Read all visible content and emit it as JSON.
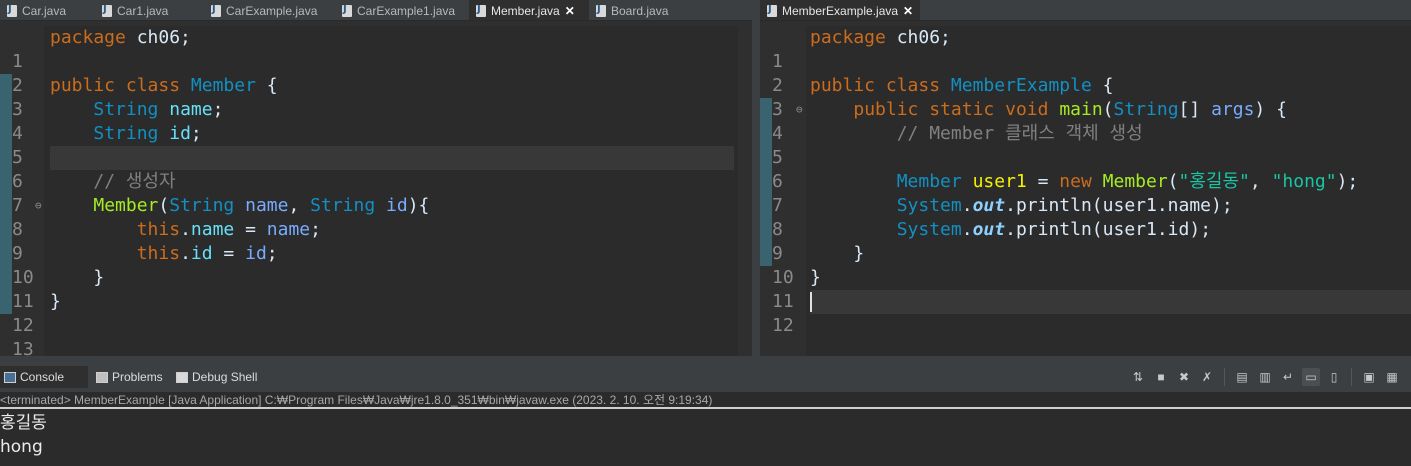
{
  "left_editor": {
    "tabs": [
      {
        "label": "Car.java"
      },
      {
        "label": "Car1.java"
      },
      {
        "label": "CarExample.java"
      },
      {
        "label": "CarExample1.java"
      },
      {
        "label": "Member.java"
      },
      {
        "label": "Board.java"
      }
    ],
    "active_tab": "Member.java",
    "line_numbers": [
      "1",
      "2",
      "3",
      "4",
      "5",
      "6",
      "7",
      "8",
      "9",
      "10",
      "11",
      "12",
      "13"
    ],
    "code": {
      "l1_kw": "package",
      "l1_rest": " ch06;",
      "l3_kw1": "public",
      "l3_kw2": "class",
      "l3_name": "Member",
      "l3_brace": " {",
      "l4_type": "String",
      "l4_field": "name",
      "l4_semi": ";",
      "l5_type": "String",
      "l5_field": "id",
      "l5_semi": ";",
      "l7_comment": "// 생성자",
      "l8_ctor": "Member",
      "l8_open": "(",
      "l8_type1": "String",
      "l8_param1": "name",
      "l8_comma": ", ",
      "l8_type2": "String",
      "l8_param2": "id",
      "l8_close": "){",
      "l9_this": "this",
      "l9_dot": ".",
      "l9_field": "name",
      "l9_eq": " = ",
      "l9_param": "name",
      "l9_semi": ";",
      "l10_this": "this",
      "l10_dot": ".",
      "l10_field": "id",
      "l10_eq": " = ",
      "l10_param": "id",
      "l10_semi": ";",
      "l11_brace": "}",
      "l12_brace": "}"
    }
  },
  "right_editor": {
    "tab": {
      "label": "MemberExample.java"
    },
    "line_numbers": [
      "1",
      "2",
      "3",
      "4",
      "5",
      "6",
      "7",
      "8",
      "9",
      "10",
      "11",
      "12"
    ],
    "code": {
      "l1_kw": "package",
      "l1_rest": " ch06;",
      "l3_kw1": "public",
      "l3_kw2": "class",
      "l3_name": "MemberExample",
      "l3_brace": " {",
      "l4_kw1": "public",
      "l4_kw2": "static",
      "l4_kw3": "void",
      "l4_method": "main",
      "l4_open": "(",
      "l4_type": "String",
      "l4_arr": "[] ",
      "l4_param": "args",
      "l4_close": ") {",
      "l5_comment": "// Member 클래스 객체 생성",
      "l7_type": "Member",
      "l7_var": "user1",
      "l7_eq": " = ",
      "l7_new": "new",
      "l7_ctor": "Member",
      "l7_open": "(",
      "l7_str1": "\"홍길동\"",
      "l7_comma": ", ",
      "l7_str2": "\"hong\"",
      "l7_close": ");",
      "l8_sys": "System",
      "l8_dot1": ".",
      "l8_out": "out",
      "l8_dot2": ".",
      "l8_method": "println",
      "l8_open": "(",
      "l8_var": "user1",
      "l8_dot3": ".",
      "l8_field": "name",
      "l8_close": ");",
      "l9_sys": "System",
      "l9_dot1": ".",
      "l9_out": "out",
      "l9_dot2": ".",
      "l9_method": "println",
      "l9_open": "(",
      "l9_var": "user1",
      "l9_dot3": ".",
      "l9_field": "id",
      "l9_close": ");",
      "l10_brace": "}",
      "l11_brace": "}"
    }
  },
  "console": {
    "tabs": [
      {
        "label": "Console"
      },
      {
        "label": "Problems"
      },
      {
        "label": "Debug Shell"
      }
    ],
    "toolbar_icons": [
      "sync-icon",
      "stop-icon",
      "remove-icon",
      "remove-all-icon",
      "clear-console-icon",
      "scroll-lock-icon",
      "word-wrap-icon",
      "show-stdout-icon",
      "show-stderr-icon",
      "pin-console-icon",
      "new-console-icon"
    ],
    "status": "<terminated> MemberExample [Java Application] C:₩Program Files₩Java₩jre1.8.0_351₩bin₩javaw.exe (2023. 2. 10. 오전 9:19:34)",
    "output": [
      "홍길동",
      "hong"
    ]
  }
}
